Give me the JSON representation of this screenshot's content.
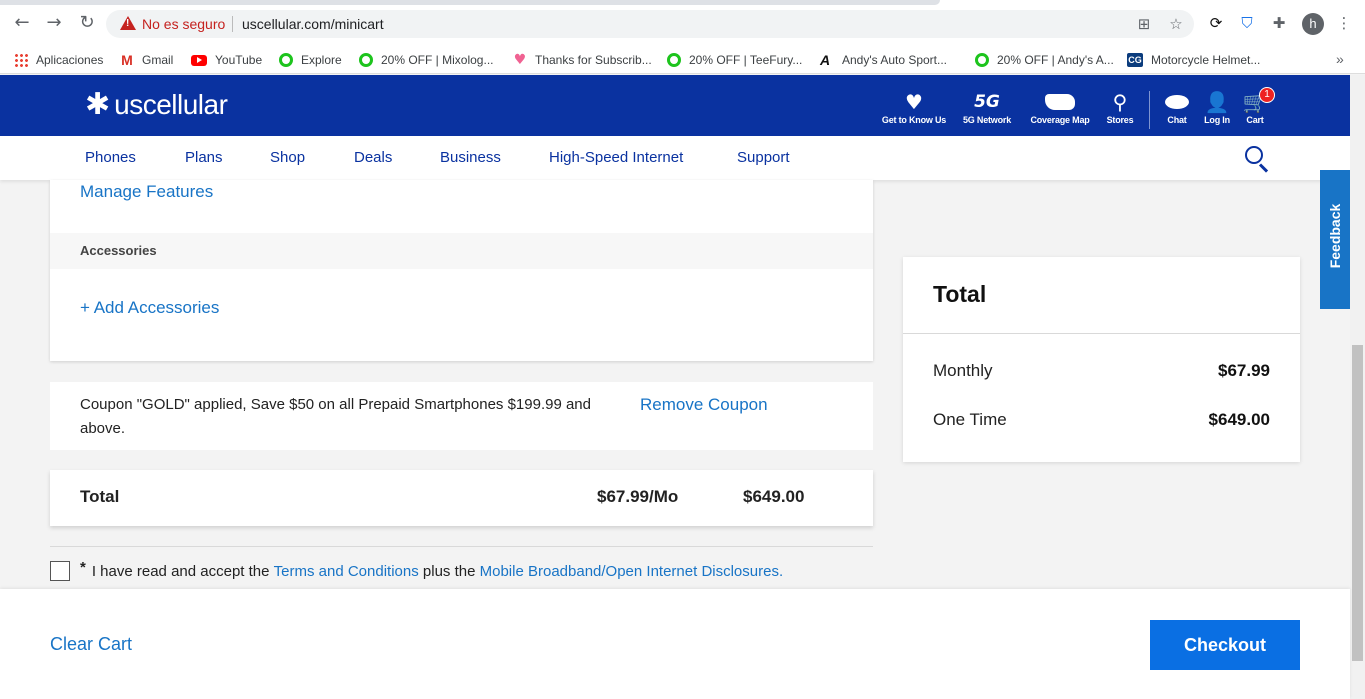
{
  "browser": {
    "not_secure": "No es seguro",
    "url": "uscellular.com/minicart",
    "profile_initial": "h",
    "bookmarks": [
      {
        "label": "Aplicaciones",
        "icon": "apps-icon"
      },
      {
        "label": "Gmail",
        "icon": "gmail-icon"
      },
      {
        "label": "YouTube",
        "icon": "youtube-icon"
      },
      {
        "label": "Explore",
        "icon": "green-ring-icon"
      },
      {
        "label": "20% OFF | Mixolog...",
        "icon": "green-ring-icon"
      },
      {
        "label": "Thanks for Subscrib...",
        "icon": "heart-icon"
      },
      {
        "label": "20% OFF | TeeFury...",
        "icon": "green-ring-icon"
      },
      {
        "label": "Andy's Auto Sport...",
        "icon": "andys-icon"
      },
      {
        "label": "20% OFF | Andy's A...",
        "icon": "green-ring-icon"
      },
      {
        "label": "Motorcycle Helmet...",
        "icon": "cg-icon"
      }
    ],
    "more": "»"
  },
  "header": {
    "logo": "uscellular",
    "nav": [
      {
        "label": "Get to Know Us",
        "icon": "heart-icon"
      },
      {
        "label": "5G Network",
        "icon": "5g-icon"
      },
      {
        "label": "Coverage Map",
        "icon": "usa-map-icon"
      },
      {
        "label": "Stores",
        "icon": "location-pin-icon"
      },
      {
        "label": "Chat",
        "icon": "chat-bubble-icon"
      },
      {
        "label": "Log In",
        "icon": "user-icon"
      },
      {
        "label": "Cart",
        "icon": "cart-icon"
      }
    ],
    "cart_count": "1",
    "five_g": "5G"
  },
  "mainnav": [
    "Phones",
    "Plans",
    "Shop",
    "Deals",
    "Business",
    "High-Speed Internet",
    "Support"
  ],
  "cart": {
    "manage_features": "Manage Features",
    "accessories_header": "Accessories",
    "add_accessories": "+  Add Accessories",
    "coupon_text": "Coupon \"GOLD\" applied, Save $50 on all Prepaid Smartphones $199.99 and above.",
    "remove_coupon": "Remove Coupon",
    "total_label": "Total",
    "total_monthly": "$67.99/Mo",
    "total_onetime": "$649.00",
    "terms_star": "*",
    "terms_prefix": "I have read and accept the",
    "terms_link": "Terms and Conditions",
    "terms_mid": "plus the",
    "terms_link2": "Mobile Broadband/Open Internet Disclosures."
  },
  "summary": {
    "title": "Total",
    "monthly_label": "Monthly",
    "monthly_value": "$67.99",
    "onetime_label": "One Time",
    "onetime_value": "$649.00"
  },
  "feedback": "Feedback",
  "footer": {
    "clear_cart": "Clear Cart",
    "checkout": "Checkout"
  }
}
